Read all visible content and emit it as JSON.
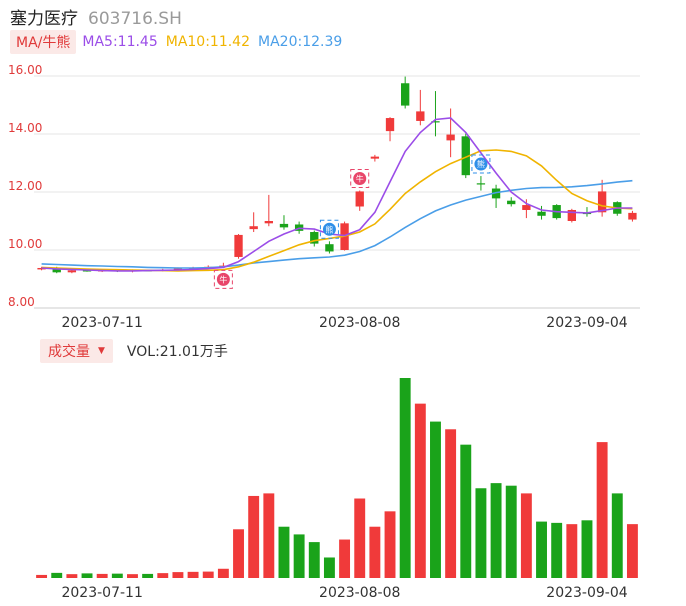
{
  "header": {
    "name": "塞力医疗",
    "code": "603716.SH"
  },
  "ma": {
    "button": "MA/牛熊",
    "ma5": "MA5:11.45",
    "ma10": "MA10:11.42",
    "ma20": "MA20:12.39",
    "colors": {
      "ma5": "#9b4de8",
      "ma10": "#f0b400",
      "ma20": "#4a9ee8"
    }
  },
  "volume": {
    "button": "成交量",
    "caret": "▼",
    "text": "VOL:21.01万手"
  },
  "colors": {
    "up": "#f03a3a",
    "down": "#1aa31a"
  },
  "chart_data": {
    "type": "candlestick",
    "ylim": [
      8.0,
      16.0
    ],
    "yticks": [
      "16.00",
      "14.00",
      "12.00",
      "10.00",
      "8.00"
    ],
    "xticks": [
      "2023-07-11",
      "2023-08-08",
      "2023-09-04"
    ],
    "candles": [
      {
        "o": 9.33,
        "c": 9.38,
        "h": 9.42,
        "l": 9.3
      },
      {
        "o": 9.38,
        "c": 9.23,
        "h": 9.42,
        "l": 9.2
      },
      {
        "o": 9.23,
        "c": 9.3,
        "h": 9.34,
        "l": 9.2
      },
      {
        "o": 9.3,
        "c": 9.28,
        "h": 9.33,
        "l": 9.25
      },
      {
        "o": 9.27,
        "c": 9.3,
        "h": 9.33,
        "l": 9.24
      },
      {
        "o": 9.3,
        "c": 9.27,
        "h": 9.32,
        "l": 9.24
      },
      {
        "o": 9.26,
        "c": 9.3,
        "h": 9.33,
        "l": 9.23
      },
      {
        "o": 9.3,
        "c": 9.29,
        "h": 9.32,
        "l": 9.26
      },
      {
        "o": 9.28,
        "c": 9.32,
        "h": 9.35,
        "l": 9.26
      },
      {
        "o": 9.32,
        "c": 9.36,
        "h": 9.4,
        "l": 9.3
      },
      {
        "o": 9.36,
        "c": 9.38,
        "h": 9.42,
        "l": 9.33
      },
      {
        "o": 9.38,
        "c": 9.42,
        "h": 9.47,
        "l": 9.35
      },
      {
        "o": 9.43,
        "c": 9.46,
        "h": 9.56,
        "l": 9.4
      },
      {
        "o": 9.76,
        "c": 10.52,
        "h": 10.55,
        "l": 9.7
      },
      {
        "o": 10.72,
        "c": 10.82,
        "h": 11.3,
        "l": 10.62
      },
      {
        "o": 10.92,
        "c": 11.0,
        "h": 11.9,
        "l": 10.82
      },
      {
        "o": 10.9,
        "c": 10.78,
        "h": 11.2,
        "l": 10.7
      },
      {
        "o": 10.88,
        "c": 10.66,
        "h": 10.98,
        "l": 10.56
      },
      {
        "o": 10.62,
        "c": 10.22,
        "h": 10.67,
        "l": 10.12
      },
      {
        "o": 10.2,
        "c": 9.95,
        "h": 10.3,
        "l": 9.88
      },
      {
        "o": 10.0,
        "c": 10.92,
        "h": 10.98,
        "l": 9.98
      },
      {
        "o": 11.5,
        "c": 12.02,
        "h": 12.05,
        "l": 11.35
      },
      {
        "o": 13.15,
        "c": 13.22,
        "h": 13.28,
        "l": 13.05
      },
      {
        "o": 14.1,
        "c": 14.55,
        "h": 14.58,
        "l": 13.75
      },
      {
        "o": 15.75,
        "c": 14.98,
        "h": 15.98,
        "l": 14.88
      },
      {
        "o": 14.45,
        "c": 14.78,
        "h": 15.52,
        "l": 14.3
      },
      {
        "o": 14.44,
        "c": 14.4,
        "h": 15.48,
        "l": 13.92
      },
      {
        "o": 13.78,
        "c": 13.98,
        "h": 14.88,
        "l": 13.2
      },
      {
        "o": 13.92,
        "c": 12.58,
        "h": 14.02,
        "l": 12.48
      },
      {
        "o": 12.3,
        "c": 12.27,
        "h": 12.55,
        "l": 12.05
      },
      {
        "o": 12.12,
        "c": 11.78,
        "h": 12.25,
        "l": 11.45
      },
      {
        "o": 11.7,
        "c": 11.58,
        "h": 11.82,
        "l": 11.5
      },
      {
        "o": 11.38,
        "c": 11.55,
        "h": 11.75,
        "l": 11.1
      },
      {
        "o": 11.32,
        "c": 11.18,
        "h": 11.52,
        "l": 11.05
      },
      {
        "o": 11.55,
        "c": 11.1,
        "h": 11.58,
        "l": 11.05
      },
      {
        "o": 11.0,
        "c": 11.38,
        "h": 11.42,
        "l": 10.95
      },
      {
        "o": 11.28,
        "c": 11.25,
        "h": 11.48,
        "l": 11.15
      },
      {
        "o": 11.3,
        "c": 12.02,
        "h": 12.42,
        "l": 11.15
      },
      {
        "o": 11.65,
        "c": 11.25,
        "h": 11.68,
        "l": 11.18
      },
      {
        "o": 11.05,
        "c": 11.28,
        "h": 11.35,
        "l": 10.98
      }
    ],
    "volume": [
      1.2,
      2.0,
      1.5,
      1.8,
      1.6,
      1.7,
      1.5,
      1.6,
      1.9,
      2.3,
      2.4,
      2.5,
      3.6,
      19,
      32,
      33,
      20,
      17,
      14,
      8,
      15,
      31,
      20,
      26,
      78,
      68,
      61,
      58,
      52,
      35,
      37,
      36,
      33,
      22,
      21.5,
      21,
      22.5,
      53,
      33,
      21.01
    ],
    "ma5": [
      9.38,
      9.35,
      9.33,
      9.31,
      9.29,
      9.28,
      9.28,
      9.29,
      9.3,
      9.31,
      9.33,
      9.36,
      9.4,
      9.6,
      9.95,
      10.3,
      10.55,
      10.75,
      10.72,
      10.55,
      10.5,
      10.7,
      11.3,
      12.35,
      13.4,
      14.05,
      14.5,
      14.55,
      14.05,
      13.35,
      12.65,
      12.0,
      11.6,
      11.38,
      11.32,
      11.3,
      11.28,
      11.36,
      11.45,
      11.45
    ],
    "ma10": [
      9.4,
      9.38,
      9.36,
      9.34,
      9.33,
      9.32,
      9.31,
      9.3,
      9.29,
      9.28,
      9.29,
      9.3,
      9.32,
      9.42,
      9.58,
      9.78,
      9.98,
      10.18,
      10.32,
      10.4,
      10.48,
      10.62,
      10.9,
      11.4,
      11.95,
      12.35,
      12.7,
      12.98,
      13.2,
      13.42,
      13.45,
      13.4,
      13.25,
      12.9,
      12.4,
      11.95,
      11.7,
      11.52,
      11.45,
      11.42
    ],
    "ma20": [
      9.52,
      9.5,
      9.48,
      9.46,
      9.45,
      9.43,
      9.42,
      9.4,
      9.39,
      9.38,
      9.38,
      9.39,
      9.42,
      9.48,
      9.55,
      9.6,
      9.65,
      9.7,
      9.73,
      9.76,
      9.82,
      9.95,
      10.15,
      10.45,
      10.78,
      11.08,
      11.35,
      11.55,
      11.72,
      11.85,
      11.98,
      12.06,
      12.12,
      12.15,
      12.16,
      12.18,
      12.22,
      12.28,
      12.34,
      12.39
    ],
    "markers": [
      {
        "index": 12,
        "label": "牛",
        "color": "#e8466a",
        "position": "below"
      },
      {
        "index": 19,
        "label": "熊",
        "color": "#2f8fe8",
        "position": "above"
      },
      {
        "index": 21,
        "label": "牛",
        "color": "#e8466a",
        "position": "above"
      },
      {
        "index": 29,
        "label": "熊",
        "color": "#2f8fe8",
        "position": "above"
      }
    ]
  }
}
